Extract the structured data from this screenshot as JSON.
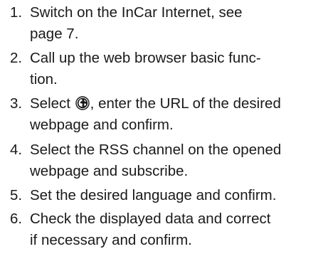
{
  "steps": [
    {
      "number": "1.",
      "lines": [
        "Switch on the InCar Internet, see",
        "page 7."
      ]
    },
    {
      "number": "2.",
      "lines": [
        "Call up the web browser basic func-",
        "tion."
      ]
    },
    {
      "number": "3.",
      "line1_before_icon": "Select ",
      "icon": "globe-icon",
      "line1_after_icon": ", enter the URL of the desired",
      "line2": "webpage and confirm."
    },
    {
      "number": "4.",
      "lines": [
        "Select the RSS channel on the opened",
        "webpage and subscribe."
      ]
    },
    {
      "number": "5.",
      "lines": [
        "Set the desired language and confirm."
      ]
    },
    {
      "number": "6.",
      "lines": [
        "Check the displayed data and correct",
        "if necessary and confirm."
      ]
    }
  ]
}
